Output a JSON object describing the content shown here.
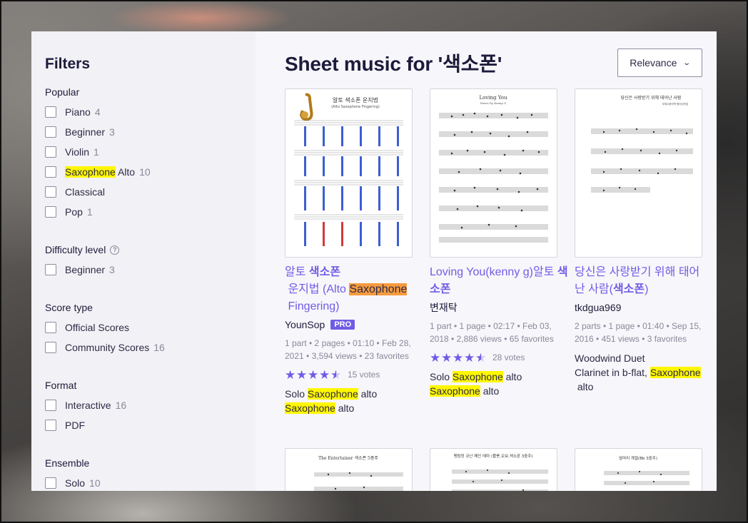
{
  "sidebar": {
    "title": "Filters",
    "groups": [
      {
        "title": "Popular",
        "items": [
          {
            "label": "Piano",
            "count": "4"
          },
          {
            "label": "Beginner",
            "count": "3"
          },
          {
            "label": "Violin",
            "count": "1"
          },
          {
            "label_hl": "Saxophone",
            "label_rest": " Alto",
            "count": "10"
          },
          {
            "label": "Classical",
            "count": ""
          },
          {
            "label": "Pop",
            "count": "1"
          }
        ]
      },
      {
        "title": "Difficulty level",
        "items": [
          {
            "label": "Beginner",
            "count": "3"
          }
        ]
      },
      {
        "title": "Score type",
        "items": [
          {
            "label": "Official Scores",
            "count": ""
          },
          {
            "label": "Community Scores",
            "count": "16"
          }
        ]
      },
      {
        "title": "Format",
        "items": [
          {
            "label": "Interactive",
            "count": "16"
          },
          {
            "label": "PDF",
            "count": ""
          }
        ]
      },
      {
        "title": "Ensemble",
        "items": [
          {
            "label": "Solo",
            "count": "10"
          }
        ]
      }
    ]
  },
  "main": {
    "title": "Sheet music for '색소폰'",
    "sort_label": "Relevance",
    "cards": [
      {
        "title_a": "알토 ",
        "title_b": "색소폰",
        "title_c": " 운지법 (Alto ",
        "title_d": "Saxophone",
        "title_e": " Fingering)",
        "author": "YounSop",
        "badge": "PRO",
        "meta": "1 part • 2 pages • 01:10 • Feb 28, 2021 • 3,594 views • 23 favorites",
        "votes": "15 votes",
        "instr_a": "Solo ",
        "instr_b": "Saxophone",
        "instr_c": " alto",
        "instr_d": "Saxophone",
        "instr_e": " alto",
        "thumb_title": "알토 색소폰 운지법",
        "thumb_subtitle": "(Alto Saxophone Fingering)"
      },
      {
        "title_a": "Loving You(kenny g)알토 ",
        "title_b": "색소폰",
        "author": "변재탁",
        "meta": "1 part • 1 page • 02:17 • Feb 03, 2018 • 2,886 views • 65 favorites",
        "votes": "28 votes",
        "instr_a": "Solo ",
        "instr_b": "Saxophone",
        "instr_c": " alto",
        "instr_d": "Saxophone",
        "instr_e": " alto",
        "thumb_title": "Loving You",
        "thumb_subtitle": "Music by Kenny G"
      },
      {
        "title_a": "당신은 사랑받기 위해 태어난 사람(",
        "title_b": "색소폰",
        "title_c": ")",
        "author": "tkdgua969",
        "meta": "2 parts • 1 page • 01:40 • Sep 15, 2016 • 451 views • 3 favorites",
        "ensemble": "Woodwind Duet",
        "instr_a": "Clarinet in b-flat, ",
        "instr_b": "Saxophone",
        "instr_c": " alto",
        "thumb_title": "당신은 사랑받기 위해 태어난 사람",
        "thumb_subtitle": "부제고음악학 원미성작업"
      }
    ],
    "row2_thumb_titles": [
      "The Entertainer 색소폰 5중주",
      "맹탐정 코난 메인 테마 (플룻,오보,색소폰 3중주)",
      "앞머리 계절(Bb 3중주)"
    ]
  },
  "colors": {
    "accent": "#6f5ce6",
    "highlight_yellow": "#fff700",
    "highlight_orange": "#f79a3e"
  }
}
